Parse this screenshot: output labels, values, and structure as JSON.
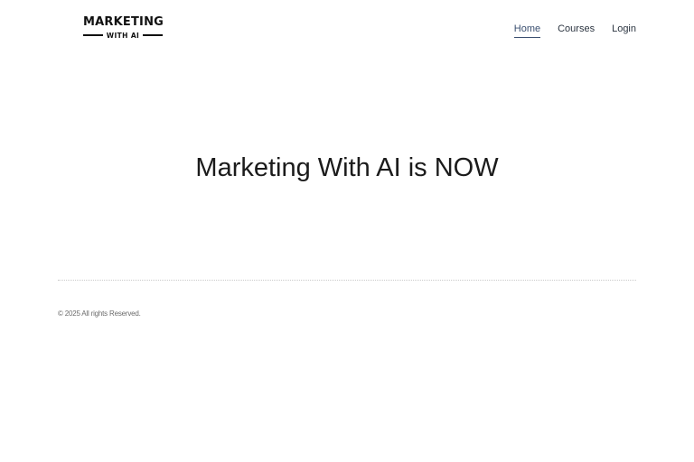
{
  "header": {
    "logo": {
      "title": "MARKETING",
      "subtitle": "WITH AI"
    },
    "nav": {
      "items": [
        {
          "label": "Home",
          "active": true
        },
        {
          "label": "Courses",
          "active": false
        },
        {
          "label": "Login",
          "active": false
        }
      ]
    }
  },
  "hero": {
    "title": "Marketing With AI is NOW"
  },
  "footer": {
    "copyright": "© 2025 All rights Reserved."
  },
  "colors": {
    "background": "#ffffff",
    "text": "#1b1b1b",
    "nav_active": "#3a4f70"
  }
}
